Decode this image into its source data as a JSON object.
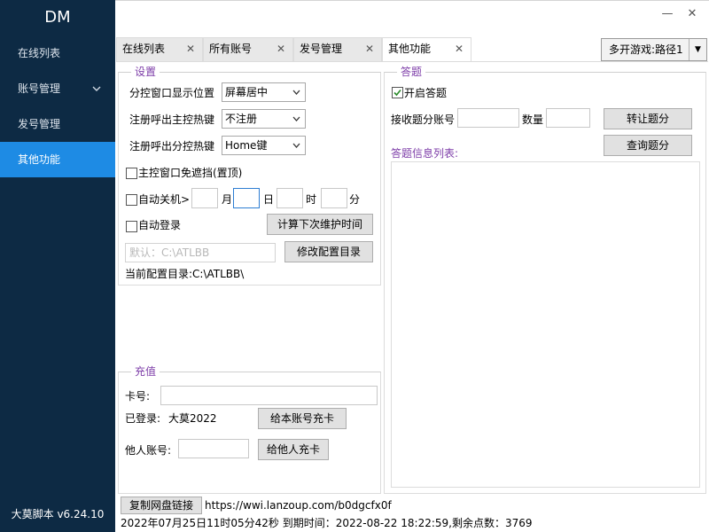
{
  "sidebar": {
    "logo": "DM",
    "items": [
      {
        "label": "在线列表"
      },
      {
        "label": "账号管理",
        "chevron": "chevron-down-icon"
      },
      {
        "label": "发号管理"
      },
      {
        "label": "其他功能",
        "active": true
      }
    ],
    "version": "大莫脚本 v6.24.10"
  },
  "window": {
    "minimize": "—",
    "close": "✕"
  },
  "tabs": [
    {
      "label": "在线列表",
      "close": "✕"
    },
    {
      "label": "所有账号",
      "close": "✕"
    },
    {
      "label": "发号管理",
      "close": "✕"
    },
    {
      "label": "其他功能",
      "close": "✕",
      "active": true
    }
  ],
  "game_select": {
    "value": "多开游戏:路径1",
    "arrow": "▼"
  },
  "settings": {
    "legend": "设置",
    "main_window_pos": {
      "label": "分控窗口显示位置",
      "value": "屏幕居中"
    },
    "main_hotkey": {
      "label": "注册呼出主控热键",
      "value": "不注册"
    },
    "sub_hotkey": {
      "label": "注册呼出分控热键",
      "value": "Home键"
    },
    "no_occlude": {
      "label": "主控窗口免遮挡(置顶)"
    },
    "auto_shutdown": {
      "label": "自动关机>",
      "month_unit": "月",
      "day_unit": "日",
      "hour_unit": "时",
      "minute_unit": "分"
    },
    "auto_login": {
      "label": "自动登录"
    },
    "calc_button": "计算下次维护时间",
    "config_placeholder": "默认：C:\\ATLBB",
    "modify_button": "修改配置目录",
    "current_dir": "当前配置目录:C:\\ATLBB\\"
  },
  "recharge": {
    "legend": "充值",
    "card_label": "卡号:",
    "logged_in_label": "已登录:",
    "logged_in_user": "大莫2022",
    "recharge_self_button": "给本账号充卡",
    "other_account_label": "他人账号:",
    "recharge_other_button": "给他人充卡"
  },
  "quiz": {
    "legend": "答题",
    "enable_label": "开启答题",
    "enable_checked": true,
    "receive_account_label": "接收题分账号",
    "quantity_label": "数量",
    "transfer_button": "转让题分",
    "query_button": "查询题分",
    "info_list_label": "答题信息列表:"
  },
  "footer": {
    "copy_button": "复制网盘链接",
    "link": "https://wwi.lanzoup.com/b0dgcfx0f",
    "status": "2022年07月25日11时05分42秒 到期时间：2022-08-22 18:22:59,剩余点数：3769"
  },
  "colors": {
    "sidebar_bg": "#0d2a44",
    "active_nav": "#1e8be4",
    "legend": "#7d3da8"
  }
}
